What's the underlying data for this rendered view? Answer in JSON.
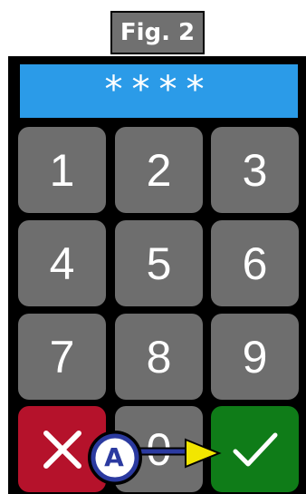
{
  "figure": {
    "label": "Fig. 2"
  },
  "display": {
    "masked_pin": "****"
  },
  "keypad": {
    "keys": [
      "1",
      "2",
      "3",
      "4",
      "5",
      "6",
      "7",
      "8",
      "9",
      "0"
    ]
  },
  "callout": {
    "letter": "A"
  },
  "colors": {
    "display": "#2b9be8",
    "key": "#6e6e6e",
    "cancel": "#b5122b",
    "confirm": "#0f7c18",
    "callout": "#2b3aa0",
    "arrow": "#f2e600"
  },
  "icons": {
    "cancel": "x-icon",
    "confirm": "check-icon"
  }
}
